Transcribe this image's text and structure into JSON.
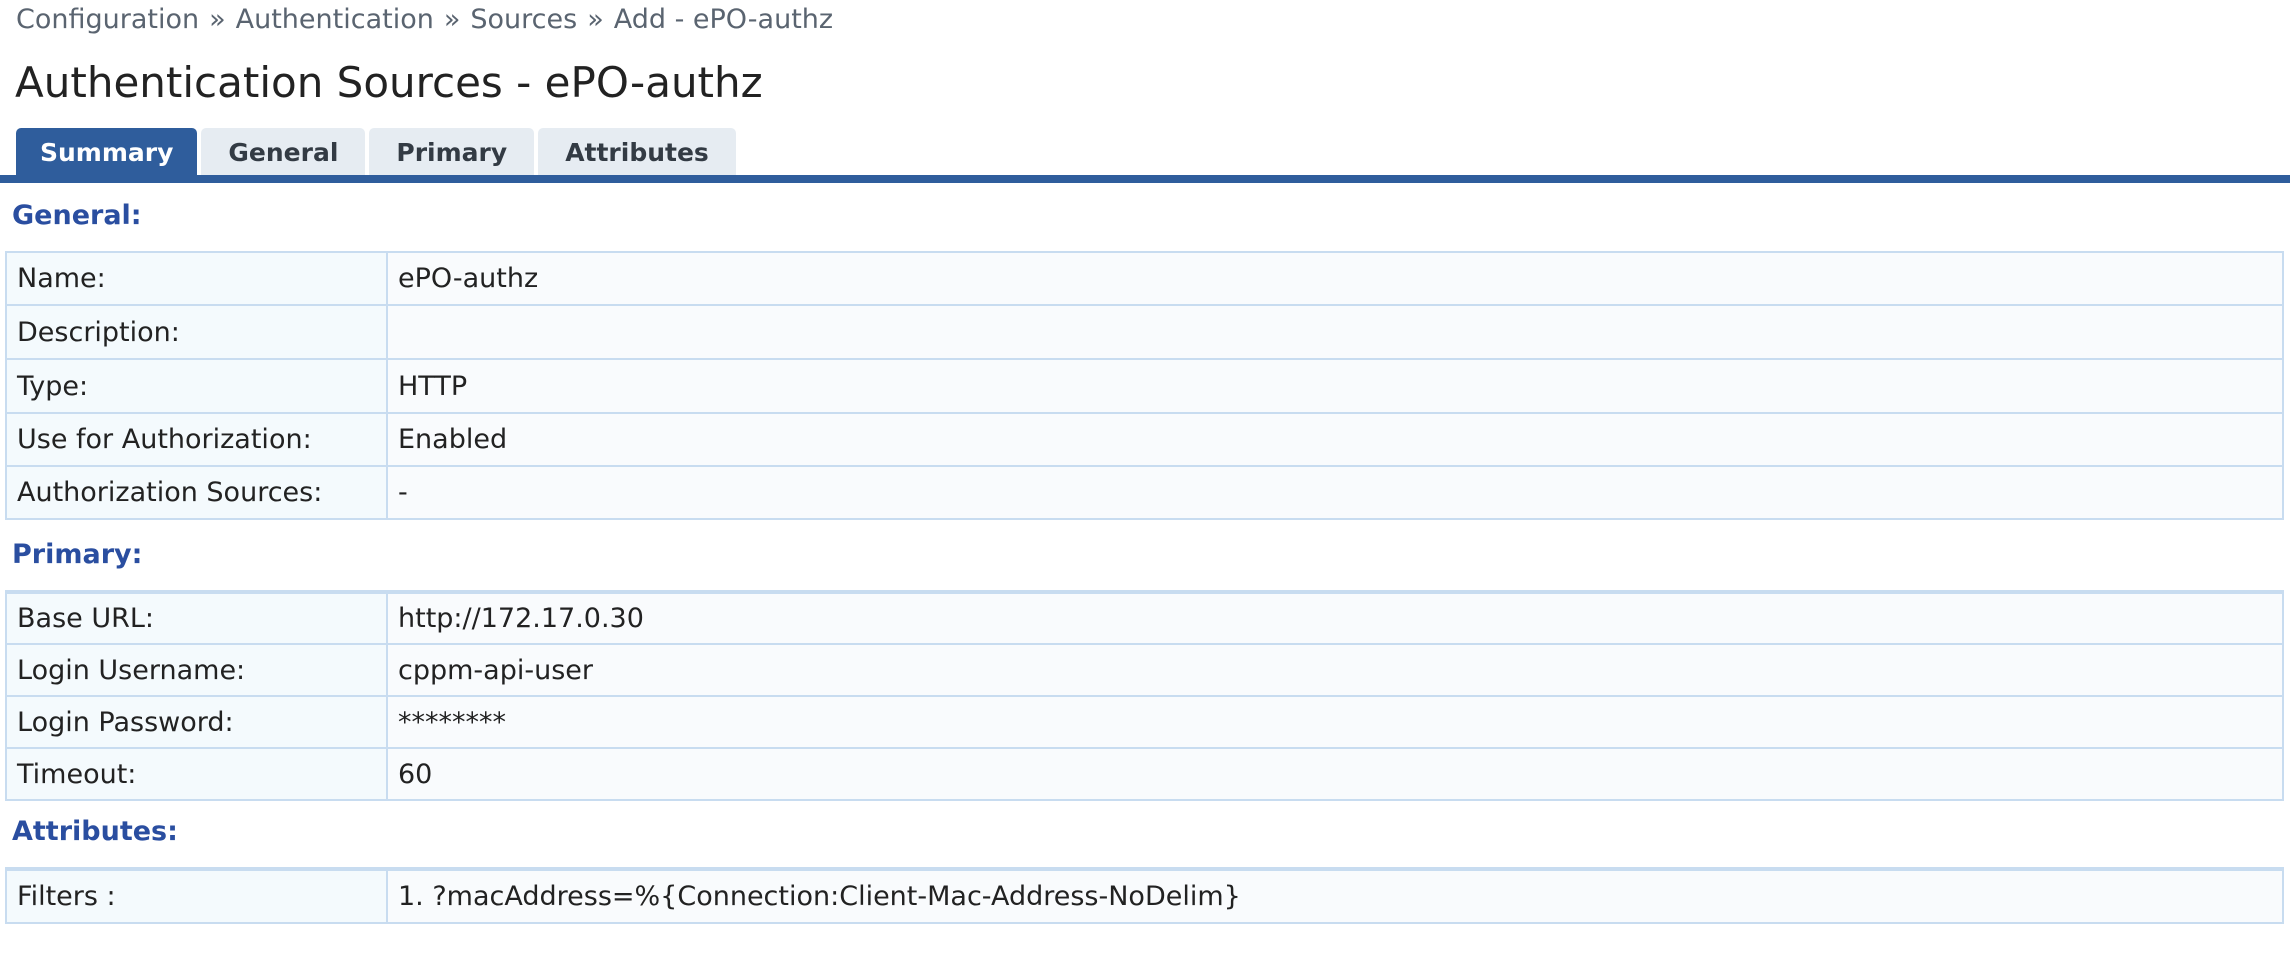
{
  "breadcrumb": {
    "items": [
      "Configuration",
      "Authentication",
      "Sources",
      "Add - ePO-authz"
    ],
    "separator": "»"
  },
  "page_title": "Authentication Sources - ePO-authz",
  "tabs": [
    {
      "label": "Summary",
      "active": true
    },
    {
      "label": "General",
      "active": false
    },
    {
      "label": "Primary",
      "active": false
    },
    {
      "label": "Attributes",
      "active": false
    }
  ],
  "sections": {
    "general": {
      "heading": "General:",
      "rows": [
        {
          "label": "Name:",
          "value": "ePO-authz"
        },
        {
          "label": "Description:",
          "value": ""
        },
        {
          "label": "Type:",
          "value": "HTTP"
        },
        {
          "label": "Use for Authorization:",
          "value": "Enabled"
        },
        {
          "label": "Authorization Sources:",
          "value": "-"
        }
      ]
    },
    "primary": {
      "heading": "Primary:",
      "rows": [
        {
          "label": "Base URL:",
          "value": "http://172.17.0.30"
        },
        {
          "label": "Login Username:",
          "value": "cppm-api-user"
        },
        {
          "label": "Login Password:",
          "value": "********"
        },
        {
          "label": "Timeout:",
          "value": "60"
        }
      ]
    },
    "attributes": {
      "heading": "Attributes:",
      "rows": [
        {
          "label": "Filters :",
          "value": "1. ?macAddress=%{Connection:Client-Mac-Address-NoDelim}"
        }
      ]
    }
  },
  "colors": {
    "accent": "#2f5d9c",
    "section_heading": "#2a4ea0",
    "tab_inactive": "#e6ecf2",
    "table_border": "#c8dcf0"
  }
}
